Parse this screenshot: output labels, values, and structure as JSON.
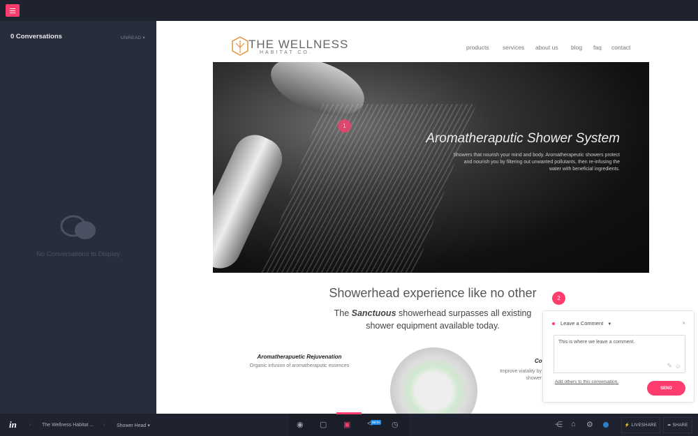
{
  "sidebar": {
    "title": "0 Conversations",
    "filter": "UNREAD",
    "empty": "No Conversations to Display"
  },
  "site": {
    "logo_main": "THE WELLNESS",
    "logo_sub": "HABITAT CO.",
    "nav": [
      "products",
      "services",
      "about us",
      "blog",
      "faq",
      "contact"
    ],
    "hero_title": "Aromatheraputic Shower System",
    "hero_text": "Showers that nourish your mind and body. Aromatherapeutic showers protect and nourish you by filtering out unwanted pollutants, then re-infusing the water with beneficial ingredients.",
    "section_title": "Showerhead experience like no other",
    "section_sub_pre": "The ",
    "section_sub_em": "Sanctuous",
    "section_sub_post": " showerhead surpasses all existing shower equipment available today.",
    "feature1_title": "Aromatherapuetic Rejuvenation",
    "feature1_text": "Organic infusion of aromatheraputic essences",
    "feature2_title": "Co",
    "feature2_text": "Improve viatality by shower"
  },
  "pins": [
    "1",
    "2"
  ],
  "comment": {
    "title": "Leave a Comment",
    "text": "This is where we leave a comment.",
    "add_others": "Add others to this conversation.",
    "send": "SEND"
  },
  "bottombar": {
    "project": "The Wellness Habitat ...",
    "screen": "Shower Head",
    "beta": "BETA",
    "liveshare": "LIVESHARE",
    "share": "SHARE"
  },
  "colors": {
    "accent": "#ff3c6e",
    "dark": "#1f2330",
    "sidebar": "#282d3b"
  }
}
